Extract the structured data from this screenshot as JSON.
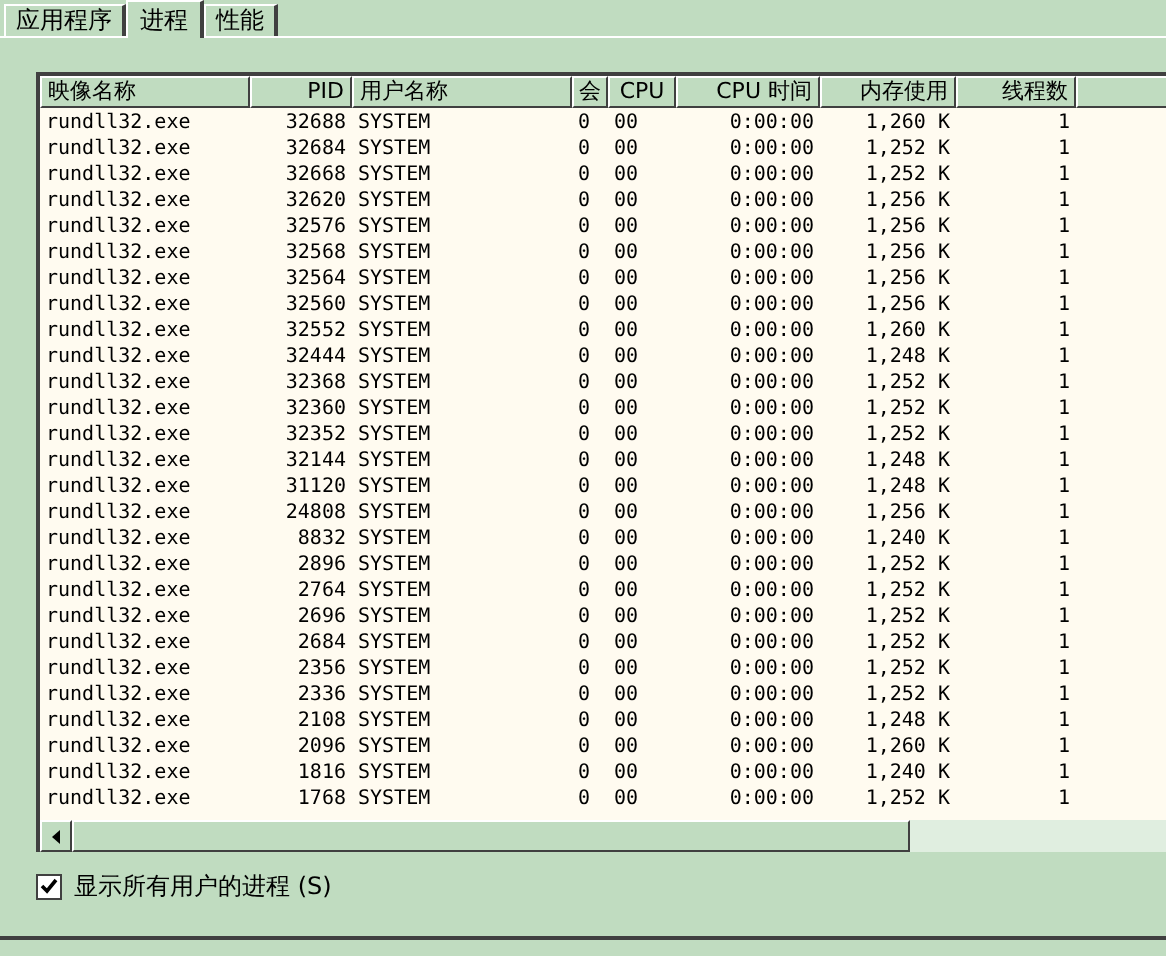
{
  "tabs": [
    {
      "label": "应用程序",
      "selected": false
    },
    {
      "label": "进程",
      "selected": true
    },
    {
      "label": "性能",
      "selected": false
    }
  ],
  "table": {
    "columns": [
      "映像名称",
      "PID",
      "用户名称",
      "会",
      "CPU",
      "CPU 时间",
      "内存使用",
      "线程数"
    ],
    "rows": [
      [
        "rundll32.exe",
        "32688",
        "SYSTEM",
        "0",
        "00",
        "0:00:00",
        "1,260 K",
        "1"
      ],
      [
        "rundll32.exe",
        "32684",
        "SYSTEM",
        "0",
        "00",
        "0:00:00",
        "1,252 K",
        "1"
      ],
      [
        "rundll32.exe",
        "32668",
        "SYSTEM",
        "0",
        "00",
        "0:00:00",
        "1,252 K",
        "1"
      ],
      [
        "rundll32.exe",
        "32620",
        "SYSTEM",
        "0",
        "00",
        "0:00:00",
        "1,256 K",
        "1"
      ],
      [
        "rundll32.exe",
        "32576",
        "SYSTEM",
        "0",
        "00",
        "0:00:00",
        "1,256 K",
        "1"
      ],
      [
        "rundll32.exe",
        "32568",
        "SYSTEM",
        "0",
        "00",
        "0:00:00",
        "1,256 K",
        "1"
      ],
      [
        "rundll32.exe",
        "32564",
        "SYSTEM",
        "0",
        "00",
        "0:00:00",
        "1,256 K",
        "1"
      ],
      [
        "rundll32.exe",
        "32560",
        "SYSTEM",
        "0",
        "00",
        "0:00:00",
        "1,256 K",
        "1"
      ],
      [
        "rundll32.exe",
        "32552",
        "SYSTEM",
        "0",
        "00",
        "0:00:00",
        "1,260 K",
        "1"
      ],
      [
        "rundll32.exe",
        "32444",
        "SYSTEM",
        "0",
        "00",
        "0:00:00",
        "1,248 K",
        "1"
      ],
      [
        "rundll32.exe",
        "32368",
        "SYSTEM",
        "0",
        "00",
        "0:00:00",
        "1,252 K",
        "1"
      ],
      [
        "rundll32.exe",
        "32360",
        "SYSTEM",
        "0",
        "00",
        "0:00:00",
        "1,252 K",
        "1"
      ],
      [
        "rundll32.exe",
        "32352",
        "SYSTEM",
        "0",
        "00",
        "0:00:00",
        "1,252 K",
        "1"
      ],
      [
        "rundll32.exe",
        "32144",
        "SYSTEM",
        "0",
        "00",
        "0:00:00",
        "1,248 K",
        "1"
      ],
      [
        "rundll32.exe",
        "31120",
        "SYSTEM",
        "0",
        "00",
        "0:00:00",
        "1,248 K",
        "1"
      ],
      [
        "rundll32.exe",
        "24808",
        "SYSTEM",
        "0",
        "00",
        "0:00:00",
        "1,256 K",
        "1"
      ],
      [
        "rundll32.exe",
        "8832",
        "SYSTEM",
        "0",
        "00",
        "0:00:00",
        "1,240 K",
        "1"
      ],
      [
        "rundll32.exe",
        "2896",
        "SYSTEM",
        "0",
        "00",
        "0:00:00",
        "1,252 K",
        "1"
      ],
      [
        "rundll32.exe",
        "2764",
        "SYSTEM",
        "0",
        "00",
        "0:00:00",
        "1,252 K",
        "1"
      ],
      [
        "rundll32.exe",
        "2696",
        "SYSTEM",
        "0",
        "00",
        "0:00:00",
        "1,252 K",
        "1"
      ],
      [
        "rundll32.exe",
        "2684",
        "SYSTEM",
        "0",
        "00",
        "0:00:00",
        "1,252 K",
        "1"
      ],
      [
        "rundll32.exe",
        "2356",
        "SYSTEM",
        "0",
        "00",
        "0:00:00",
        "1,252 K",
        "1"
      ],
      [
        "rundll32.exe",
        "2336",
        "SYSTEM",
        "0",
        "00",
        "0:00:00",
        "1,252 K",
        "1"
      ],
      [
        "rundll32.exe",
        "2108",
        "SYSTEM",
        "0",
        "00",
        "0:00:00",
        "1,248 K",
        "1"
      ],
      [
        "rundll32.exe",
        "2096",
        "SYSTEM",
        "0",
        "00",
        "0:00:00",
        "1,260 K",
        "1"
      ],
      [
        "rundll32.exe",
        "1816",
        "SYSTEM",
        "0",
        "00",
        "0:00:00",
        "1,240 K",
        "1"
      ],
      [
        "rundll32.exe",
        "1768",
        "SYSTEM",
        "0",
        "00",
        "0:00:00",
        "1,252 K",
        "1"
      ]
    ]
  },
  "show_all_users": {
    "label": "显示所有用户的进程 (S)",
    "checked": true
  }
}
